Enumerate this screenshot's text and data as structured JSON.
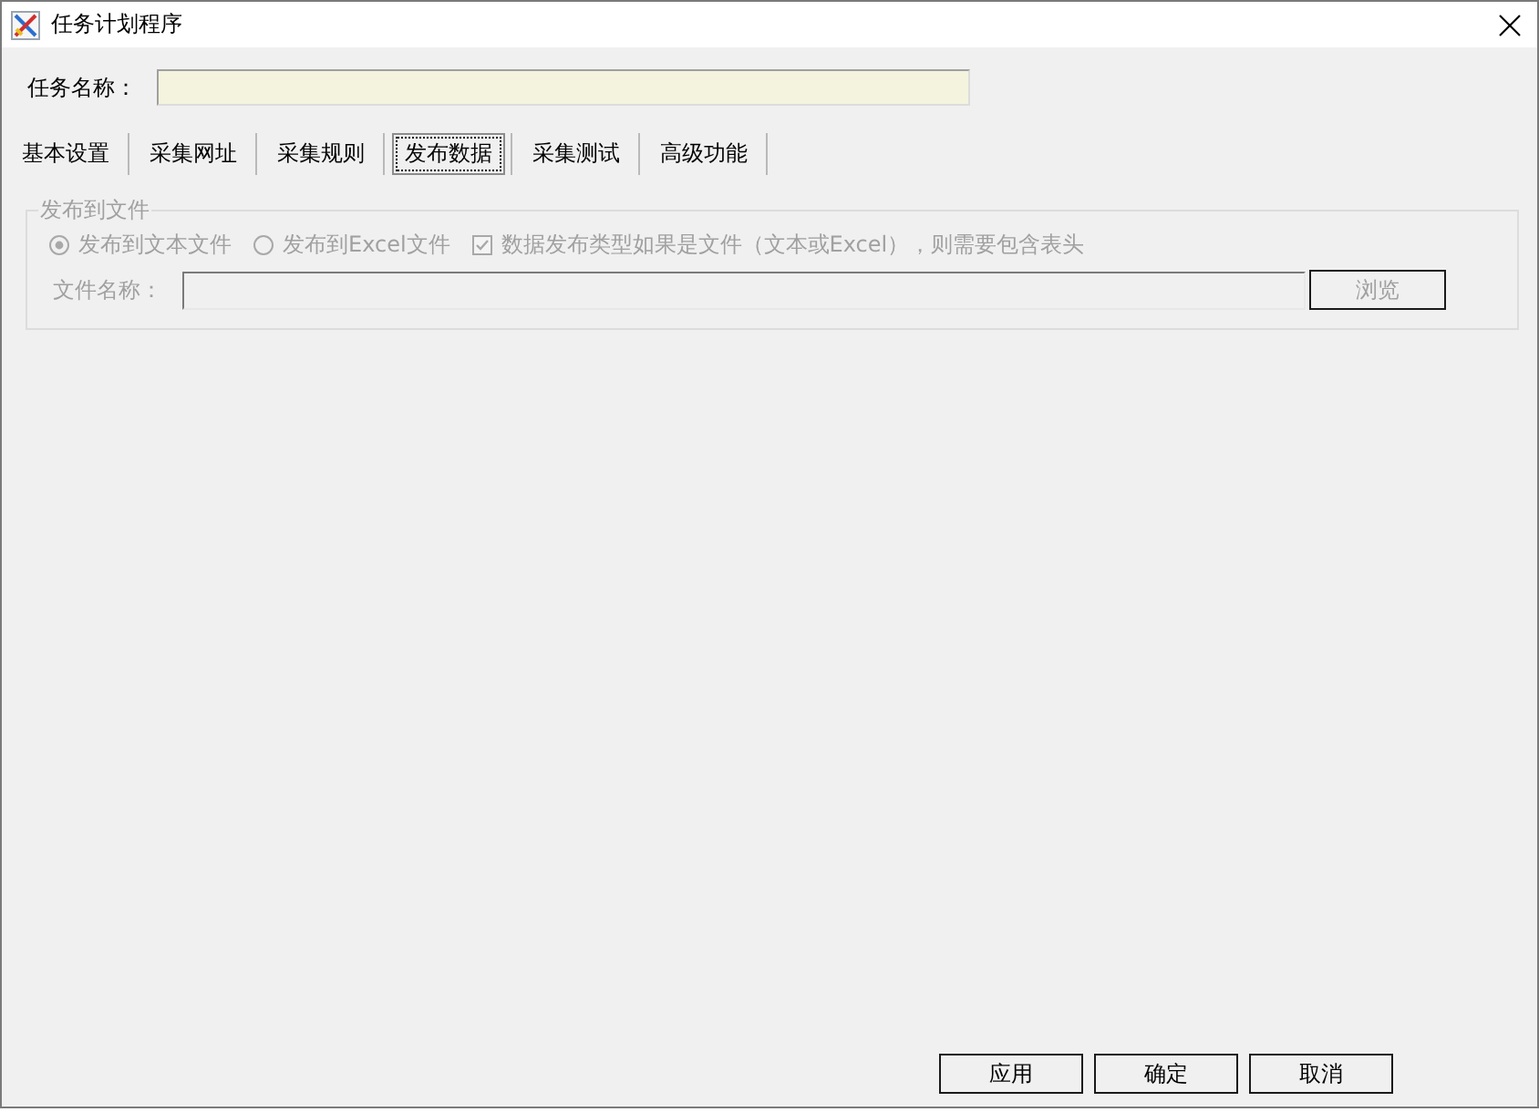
{
  "window": {
    "title": "任务计划程序"
  },
  "task_name": {
    "label": "任务名称："
  },
  "tabs": [
    {
      "label": "基本设置",
      "selected": false
    },
    {
      "label": "采集网址",
      "selected": false
    },
    {
      "label": "采集规则",
      "selected": false
    },
    {
      "label": "发布数据",
      "selected": true
    },
    {
      "label": "采集测试",
      "selected": false
    },
    {
      "label": "高级功能",
      "selected": false
    }
  ],
  "publish_to_file": {
    "title": "发布到文件",
    "disabled": true,
    "options": [
      {
        "kind": "radio",
        "label": "发布到文本文件",
        "selected": true
      },
      {
        "kind": "radio",
        "label": "发布到Excel文件",
        "selected": false
      },
      {
        "kind": "checkbox",
        "label": "数据发布类型如果是文件（文本或Excel），则需要包含表头",
        "checked": true
      }
    ],
    "file_name": {
      "label": "文件名称："
    },
    "browse_button": "浏览"
  },
  "buttons": [
    "应用",
    "确定",
    "取消"
  ]
}
